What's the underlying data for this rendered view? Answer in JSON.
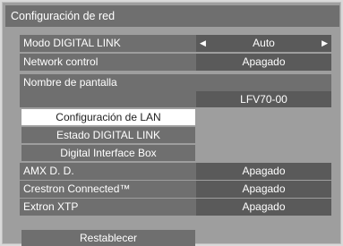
{
  "title": "Configuración de red",
  "rows": {
    "digital_link": {
      "label": "Modo DIGITAL LINK",
      "value": "Auto"
    },
    "network_control": {
      "label": "Network control",
      "value": "Apagado"
    },
    "display_name": {
      "label": "Nombre de pantalla",
      "value": "LFV70-00"
    }
  },
  "submenu": {
    "lan": "Configuración de LAN",
    "status": "Estado DIGITAL LINK",
    "box": "Digital Interface Box"
  },
  "rows2": {
    "amx": {
      "label": "AMX D. D.",
      "value": "Apagado"
    },
    "crestron": {
      "label": "Crestron Connected™",
      "value": "Apagado"
    },
    "extron": {
      "label": "Extron XTP",
      "value": "Apagado"
    }
  },
  "reset_label": "Restablecer",
  "colors": {
    "background": "#d9d9d9",
    "panel": "#9e9e9e",
    "row": "#6f6f6f",
    "value": "#5a5a5a",
    "selected": "#ffffff"
  },
  "icons": {
    "left": "triangle-left-icon",
    "right": "triangle-right-icon"
  }
}
